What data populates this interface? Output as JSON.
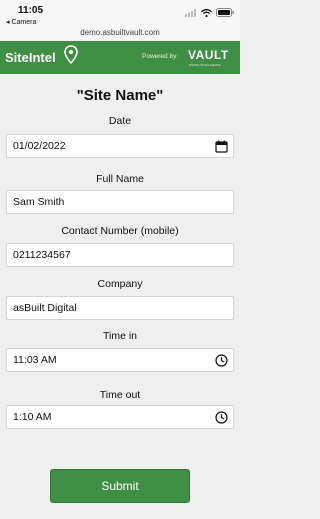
{
  "status_bar": {
    "time": "11:05",
    "back_label": "◂ Camera",
    "url": "demo.asbuiltvault.com"
  },
  "header": {
    "brand": "SiteIntel",
    "powered_by": "Powered by:",
    "partner": "VAULT",
    "partner_tagline": "DIGITAL INTELLIGENCE",
    "accent_color": "#3e8f43"
  },
  "page": {
    "title": "\"Site Name\""
  },
  "form": {
    "date": {
      "label": "Date",
      "value": "01/02/2022",
      "icon": "calendar-icon"
    },
    "full_name": {
      "label": "Full Name",
      "value": "Sam Smith"
    },
    "contact": {
      "label": "Contact Number (mobile)",
      "value": "0211234567"
    },
    "company": {
      "label": "Company",
      "value": "asBuilt Digital"
    },
    "time_in": {
      "label": "Time in",
      "value": "11:03 AM",
      "icon": "clock-icon"
    },
    "time_out": {
      "label": "Time out",
      "value": "1:10 AM",
      "icon": "clock-icon"
    },
    "submit_label": "Submit"
  }
}
